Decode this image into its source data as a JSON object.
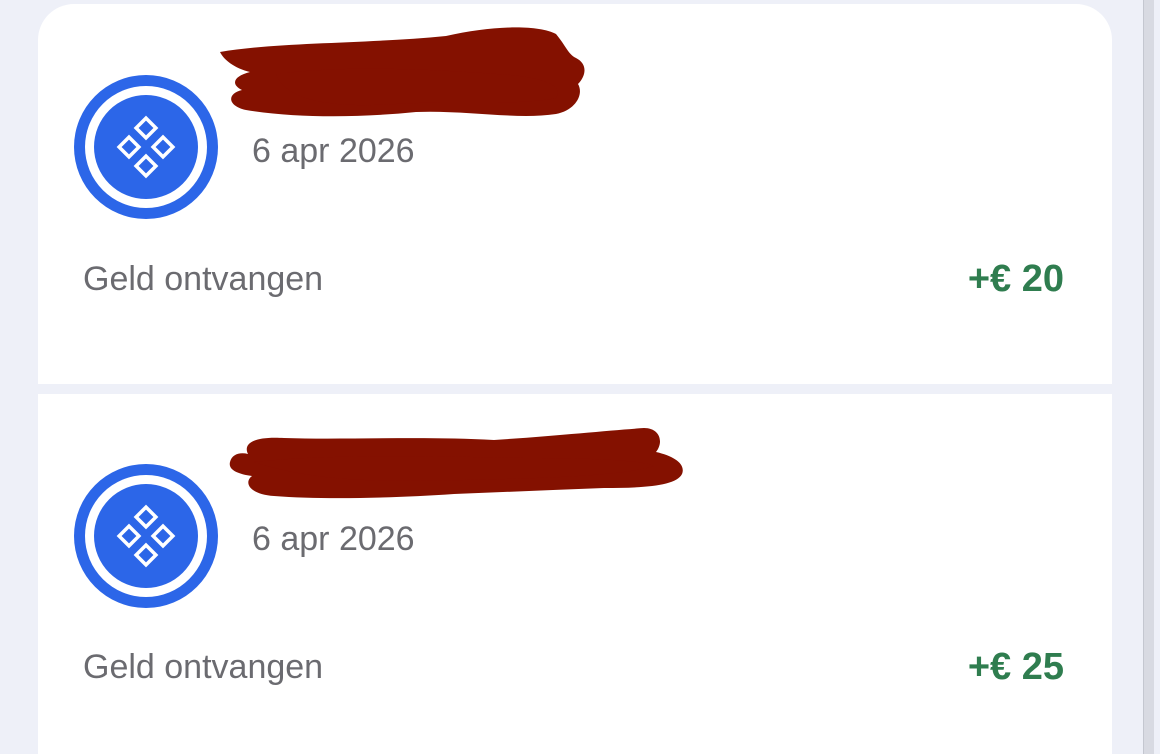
{
  "colors": {
    "background": "#eef0f8",
    "card": "#ffffff",
    "brand_blue": "#2c66e8",
    "amount_green": "#2f7d4f",
    "text_gray": "#6b6b70",
    "redaction": "#841100"
  },
  "transactions": [
    {
      "icon": "bank-logo-icon",
      "date": "6 apr 2026",
      "description": "Geld ontvangen",
      "amount": "+€ 20"
    },
    {
      "icon": "bank-logo-icon",
      "date": "6 apr 2026",
      "description": "Geld ontvangen",
      "amount": "+€ 25"
    }
  ]
}
